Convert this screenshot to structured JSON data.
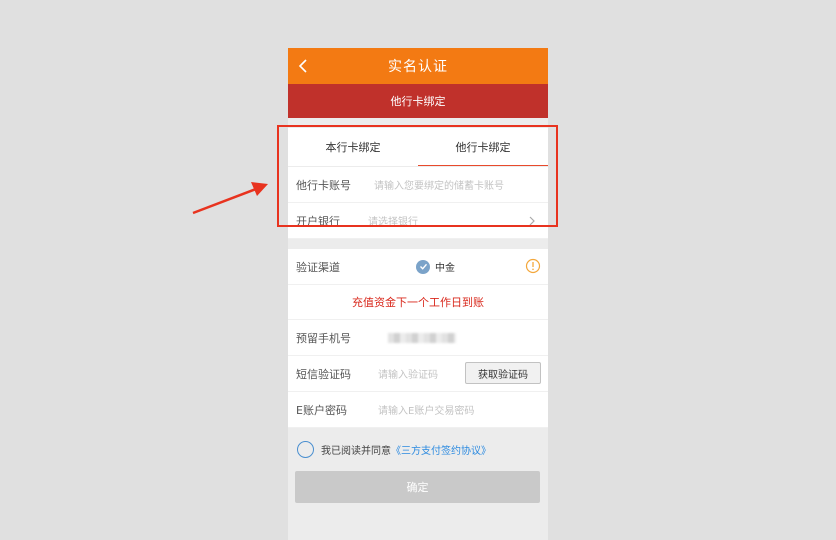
{
  "header": {
    "title": "实名认证",
    "subtitle": "他行卡绑定",
    "back_icon": "chevron-left-icon"
  },
  "tabs": [
    {
      "label": "本行卡绑定",
      "active": false
    },
    {
      "label": "他行卡绑定",
      "active": true
    }
  ],
  "card_form": {
    "account": {
      "label": "他行卡账号",
      "placeholder": "请输入您要绑定的储蓄卡账号"
    },
    "bank": {
      "label": "开户银行",
      "placeholder": "请选择银行",
      "icon": "chevron-right-icon"
    }
  },
  "verify": {
    "channel": {
      "label": "验证渠道",
      "value": "中金",
      "icon": "check-circle-icon",
      "info_icon": "warning-icon"
    },
    "notice": "充值资金下一个工作日到账",
    "phone": {
      "label": "预留手机号"
    },
    "sms": {
      "label": "短信验证码",
      "placeholder": "请输入验证码",
      "button": "获取验证码"
    },
    "password": {
      "label": "E账户密码",
      "placeholder": "请输入E账户交易密码"
    }
  },
  "agreement": {
    "prefix": "我已阅读并同意",
    "link": "《三方支付签约协议》"
  },
  "confirm_label": "确定",
  "colors": {
    "topbar": "#f37a13",
    "subbar": "#c0312b",
    "highlight": "#e8331f",
    "notice": "#d9291d",
    "link": "#2b8ae0"
  }
}
